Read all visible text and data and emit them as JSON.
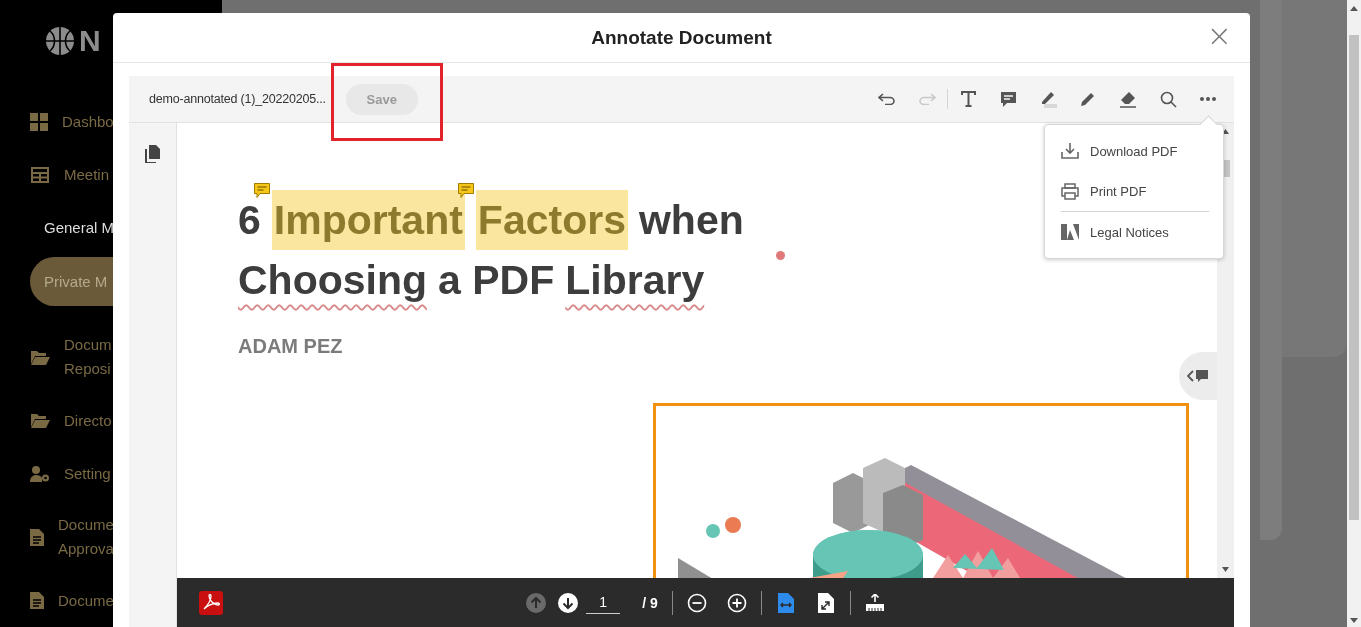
{
  "sidebar": {
    "logo_text": "N",
    "items": [
      {
        "lines": [
          "Dashbo"
        ],
        "kind": "grid",
        "selected": false
      },
      {
        "lines": [
          "Meetin"
        ],
        "kind": "table",
        "selected": false
      },
      {
        "lines": [
          "General M"
        ],
        "kind": "subitem",
        "selected": false
      },
      {
        "lines": [
          "Private M"
        ],
        "kind": "subitem",
        "selected": true
      },
      {
        "lines": [
          "Docum",
          "Reposi"
        ],
        "kind": "folder",
        "selected": false
      },
      {
        "lines": [
          "Directo"
        ],
        "kind": "folder",
        "selected": false
      },
      {
        "lines": [
          "Setting"
        ],
        "kind": "user-gear",
        "selected": false
      },
      {
        "lines": [
          "Docume",
          "Approva"
        ],
        "kind": "doc",
        "selected": false
      },
      {
        "lines": [
          "Docume"
        ],
        "kind": "doc",
        "selected": false
      }
    ]
  },
  "modal": {
    "title": "Annotate Document",
    "close": "×"
  },
  "toolbar": {
    "filename": "demo-annotated (1)_20220205...",
    "save": {
      "label": "Save",
      "disabled": true,
      "emphasized": true
    },
    "tools": [
      {
        "kind": "undo",
        "disabled": false
      },
      {
        "kind": "redo",
        "disabled": true
      },
      {
        "kind": "divider"
      },
      {
        "kind": "text",
        "disabled": false
      },
      {
        "kind": "comment",
        "disabled": false
      },
      {
        "kind": "highlight",
        "disabled": false
      },
      {
        "kind": "pencil",
        "disabled": false
      },
      {
        "kind": "eraser",
        "disabled": false
      },
      {
        "kind": "search",
        "disabled": false
      },
      {
        "kind": "more",
        "disabled": false
      }
    ]
  },
  "menu": {
    "open": true,
    "items": [
      {
        "kind": "download",
        "label": "Download PDF",
        "divider_before": false
      },
      {
        "kind": "print",
        "label": "Print PDF",
        "divider_before": false
      },
      {
        "kind": "legal",
        "label": "Legal Notices",
        "divider_before": true
      }
    ]
  },
  "document": {
    "title_lines": [
      [
        {
          "text": "6",
          "highlighted": false,
          "commented": false,
          "underlined": false
        },
        {
          "text": "Important",
          "highlighted": true,
          "commented": true,
          "underlined": false
        },
        {
          "text": "Factors",
          "highlighted": true,
          "commented": true,
          "underlined": false
        },
        {
          "text": "when",
          "highlighted": false,
          "commented": false,
          "underlined": false
        }
      ],
      [
        {
          "text": "Choosing",
          "highlighted": false,
          "commented": false,
          "underlined": true
        },
        {
          "text": "a PDF",
          "highlighted": false,
          "commented": false,
          "underlined": false
        },
        {
          "text": "Library",
          "highlighted": false,
          "commented": false,
          "underlined": true
        }
      ]
    ],
    "author": "ADAM PEZ",
    "image": {
      "kind": "picture"
    }
  },
  "bottom_bar": {
    "page": "1",
    "total": "/ 9",
    "prev_disabled": true,
    "next_disabled": false
  }
}
